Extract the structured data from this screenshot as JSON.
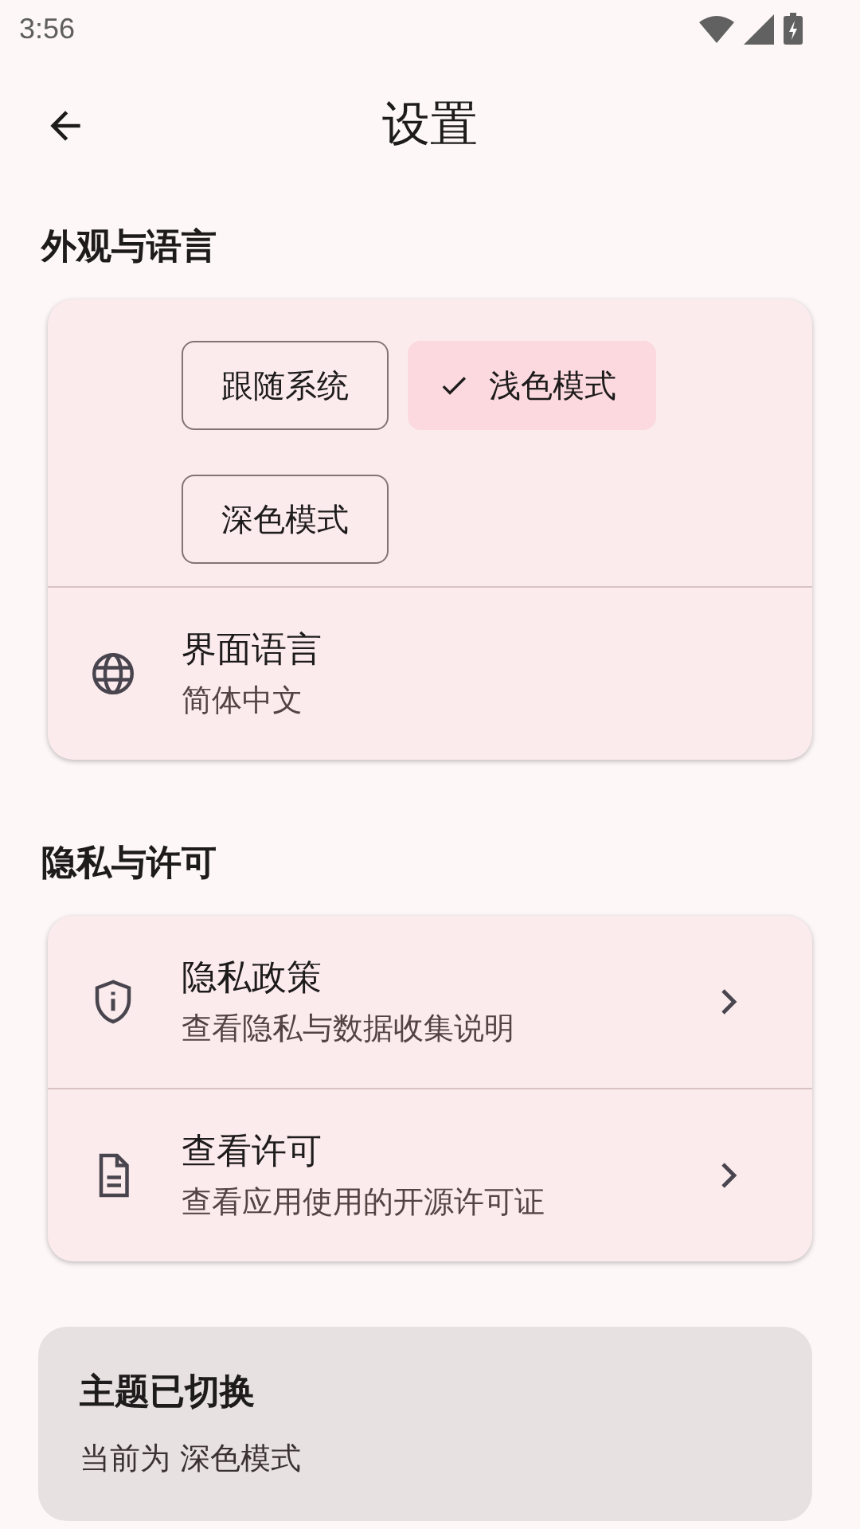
{
  "status_bar": {
    "time": "3:56"
  },
  "top_bar": {
    "title": "设置"
  },
  "sections": [
    {
      "heading": "外观与语言",
      "theme_options": [
        {
          "label": "跟随系统",
          "selected": false
        },
        {
          "label": "浅色模式",
          "selected": true
        },
        {
          "label": "深色模式",
          "selected": false
        }
      ],
      "rows": [
        {
          "kind": "selector",
          "title": "界面语言",
          "subtitle": "简体中文"
        }
      ]
    },
    {
      "heading": "隐私与许可",
      "rows": [
        {
          "kind": "link",
          "title": "隐私政策",
          "subtitle": "查看隐私与数据收集说明"
        },
        {
          "kind": "link",
          "title": "查看许可",
          "subtitle": "查看应用使用的开源许可证"
        }
      ]
    }
  ],
  "snackbar": {
    "title": "主题已切换",
    "message": "当前为 深色模式"
  }
}
